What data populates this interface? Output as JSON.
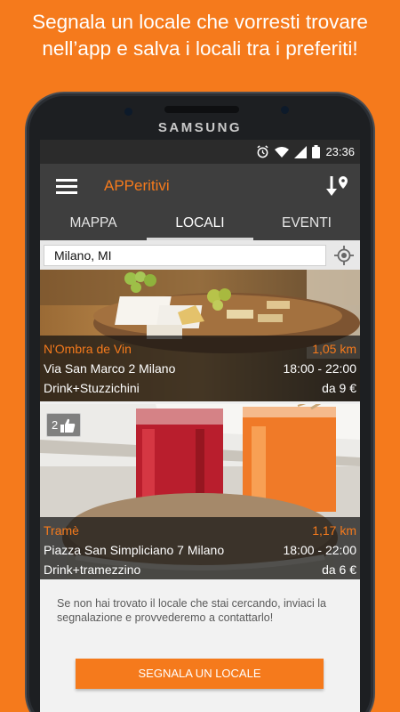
{
  "promo": {
    "line1": "Segnala un locale che vorresti trovare",
    "line2": "nell’app e salva i locali tra i preferiti!"
  },
  "device": {
    "brand": "SAMSUNG"
  },
  "status_bar": {
    "time": "23:36",
    "icons": [
      "alarm-icon",
      "wifi-icon",
      "signal-icon",
      "battery-icon"
    ]
  },
  "app_bar": {
    "title": "APPeritivi",
    "menu_icon": "hamburger-icon",
    "action_icon": "sort-location-icon"
  },
  "tabs": [
    {
      "label": "MAPPA",
      "active": false
    },
    {
      "label": "LOCALI",
      "active": true
    },
    {
      "label": "EVENTI",
      "active": false
    }
  ],
  "search": {
    "value": "Milano, MI",
    "placeholder": "",
    "action_icon": "my-location-icon"
  },
  "venues": [
    {
      "name": "N'Ombra de Vin",
      "distance": "1,05 km",
      "address": "Via San Marco 2 Milano",
      "hours": "18:00 - 22:00",
      "offer": "Drink+Stuzzichini",
      "price": "da 9 €",
      "likes": ""
    },
    {
      "name": "Tramè",
      "distance": "1,17 km",
      "address": "Piazza San Simpliciano 7 Milano",
      "hours": "18:00 - 22:00",
      "offer": "Drink+tramezzino",
      "price": "da 6 €",
      "likes": "2"
    }
  ],
  "report": {
    "note": "Se non hai trovato il locale che stai cercando, inviaci la segnalazione e provvederemo a contattarlo!",
    "button_label": "SEGNALA UN LOCALE"
  },
  "colors": {
    "accent": "#f57a1c",
    "app_bar": "#3e3e3e",
    "status_bar": "#2b2b2b"
  }
}
